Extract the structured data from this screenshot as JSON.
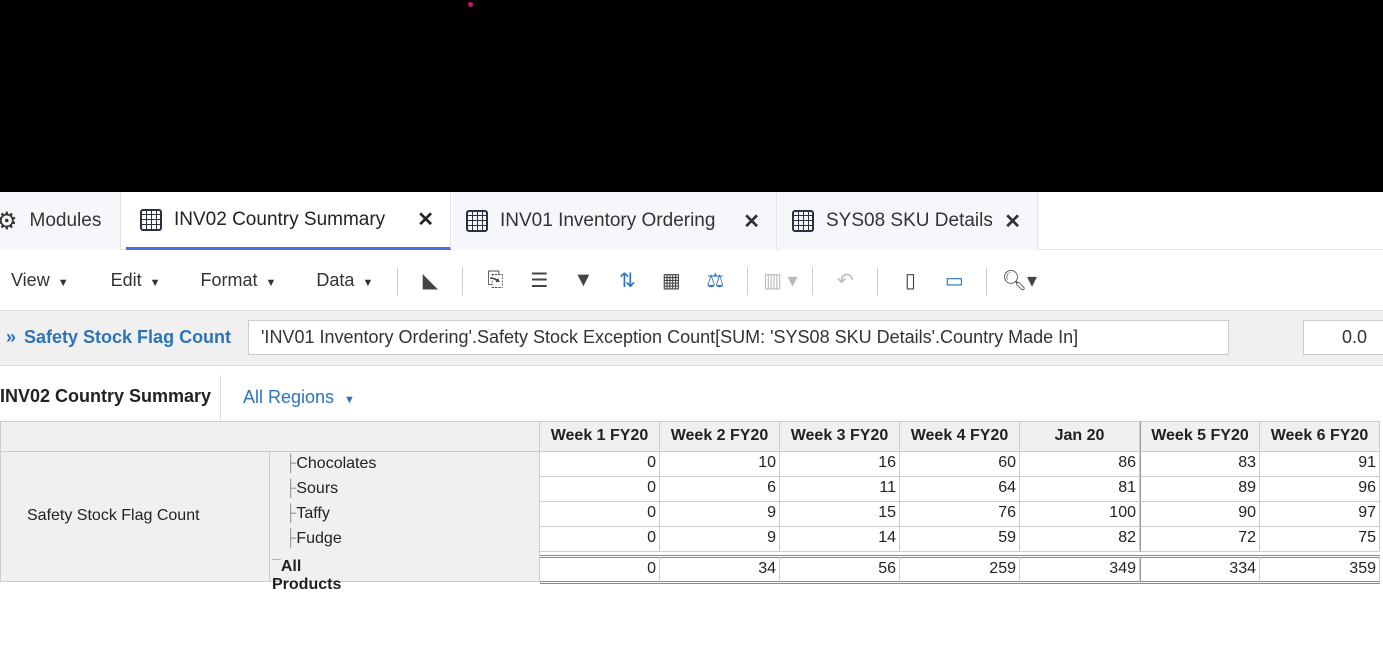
{
  "tabs": [
    {
      "label": "Modules",
      "icon": "gear-icon"
    },
    {
      "label": "INV02 Country Summary",
      "icon": "grid-icon",
      "active": true
    },
    {
      "label": "INV01 Inventory Ordering",
      "icon": "grid-icon"
    },
    {
      "label": "SYS08 SKU Details",
      "icon": "grid-icon"
    }
  ],
  "tab_close": "✕",
  "toolbar": {
    "menus": [
      "View",
      "Edit",
      "Format",
      "Data"
    ]
  },
  "formula_bar": {
    "name": "Safety Stock Flag Count",
    "formula": "'INV01 Inventory Ordering'.Safety Stock Exception Count[SUM: 'SYS08 SKU Details'.Country Made In]",
    "value": "0.0"
  },
  "view": {
    "title": "INV02 Country Summary",
    "region_filter": "All Regions"
  },
  "grid": {
    "line_item": "Safety Stock Flag Count",
    "columns": [
      "Week 1 FY20",
      "Week 2 FY20",
      "Week 3 FY20",
      "Week 4 FY20",
      "Jan 20",
      "Week 5 FY20",
      "Week 6 FY20"
    ],
    "rows": [
      {
        "label": "Chocolates",
        "values": [
          "0",
          "10",
          "16",
          "60",
          "86",
          "83",
          "91"
        ]
      },
      {
        "label": "Sours",
        "values": [
          "0",
          "6",
          "11",
          "64",
          "81",
          "89",
          "96"
        ]
      },
      {
        "label": "Taffy",
        "values": [
          "0",
          "9",
          "15",
          "76",
          "100",
          "90",
          "97"
        ]
      },
      {
        "label": "Fudge",
        "values": [
          "0",
          "9",
          "14",
          "59",
          "82",
          "72",
          "75"
        ]
      },
      {
        "label": "All Products",
        "values": [
          "0",
          "34",
          "56",
          "259",
          "349",
          "334",
          "359"
        ],
        "total": true
      }
    ]
  },
  "colors": {
    "accent": "#2d73b8",
    "active_tab": "#4a6ee0"
  }
}
